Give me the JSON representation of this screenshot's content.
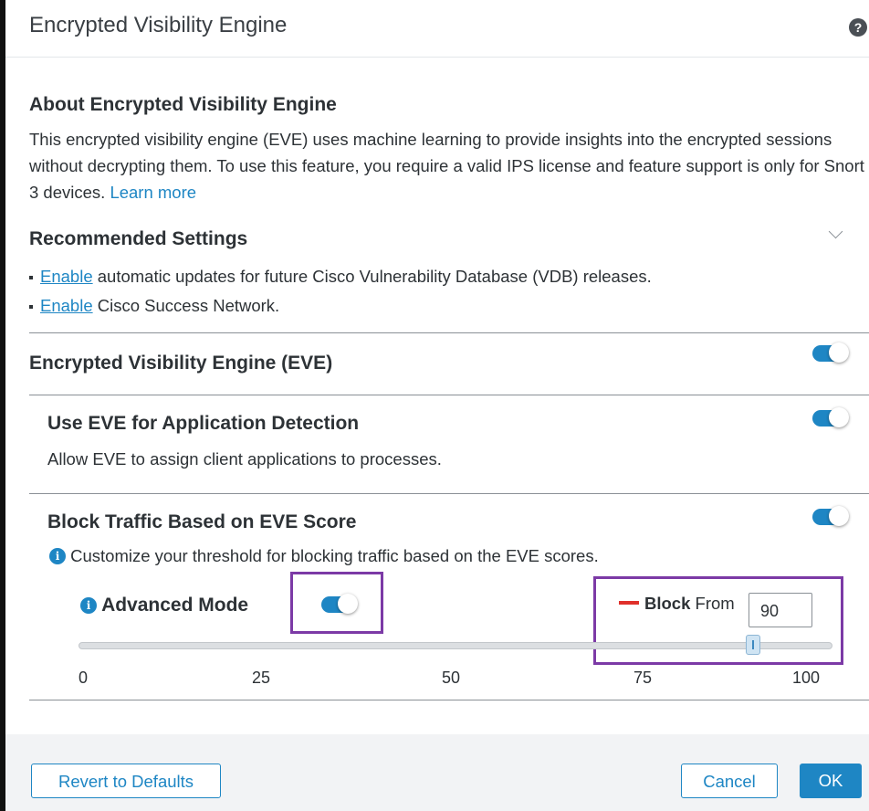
{
  "dialog": {
    "title": "Encrypted Visibility Engine",
    "help_icon": "question-circle-icon"
  },
  "about": {
    "heading": "About Encrypted Visibility Engine",
    "body": "This encrypted visibility engine (EVE) uses machine learning to provide insights into the encrypted sessions without decrypting them. To use this feature, you require a valid IPS license and feature support is only for Snort 3 devices.",
    "learn_more": "Learn more"
  },
  "recommended": {
    "heading": "Recommended Settings",
    "chevron_icon": "chevron-down-icon",
    "items": [
      {
        "link": "Enable",
        "text": "automatic updates for future Cisco Vulnerability Database (VDB) releases."
      },
      {
        "link": "Enable",
        "text": "Cisco Success Network."
      }
    ]
  },
  "eve": {
    "label": "Encrypted Visibility Engine (EVE)",
    "enabled": true
  },
  "app_detection": {
    "label": "Use EVE for Application Detection",
    "description": "Allow EVE to assign client applications to processes.",
    "enabled": true
  },
  "block_traffic": {
    "label": "Block Traffic Based on EVE Score",
    "info": "Customize your threshold for blocking traffic based on the EVE scores.",
    "enabled": true,
    "advanced_mode_label": "Advanced Mode",
    "advanced_mode_enabled": true,
    "block_bold": "Block",
    "block_from": "From",
    "block_value": "90",
    "slider_value": 90,
    "slider_min": 0,
    "slider_max": 100,
    "ticks": [
      "0",
      "25",
      "50",
      "75",
      "100"
    ]
  },
  "footer": {
    "revert": "Revert to Defaults",
    "cancel": "Cancel",
    "ok": "OK"
  },
  "colors": {
    "accent": "#1e86c4",
    "highlight": "#7c3aa6",
    "block_red": "#e0302b"
  }
}
